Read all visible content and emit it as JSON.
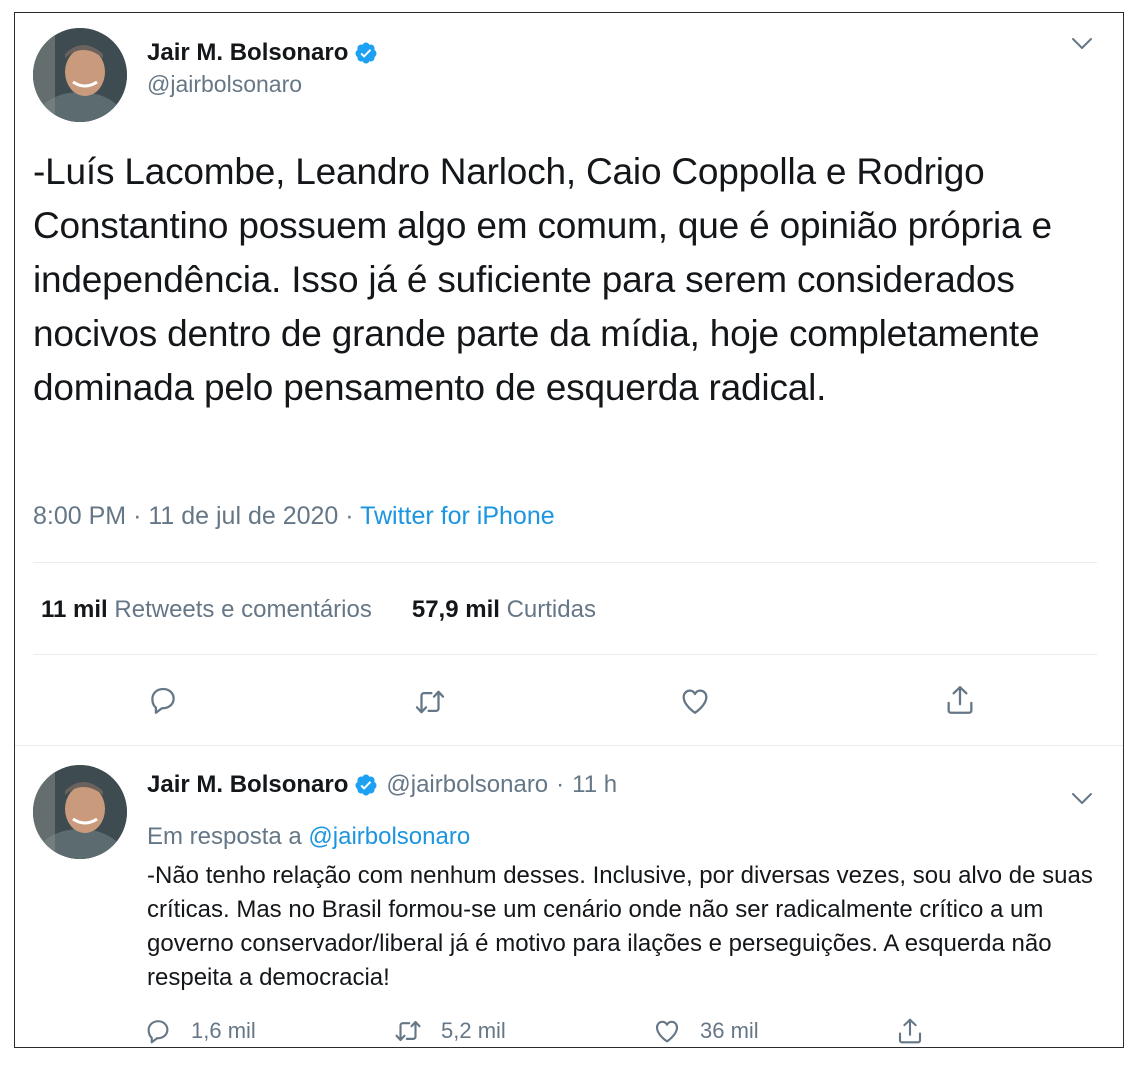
{
  "colors": {
    "text_primary": "#14171a",
    "text_secondary": "#657786",
    "link": "#1b95e0",
    "verified_badge": "#1da1f2",
    "divider": "#e6ecf0"
  },
  "main_tweet": {
    "author": {
      "name": "Jair M. Bolsonaro",
      "handle": "@jairbolsonaro",
      "verified": true
    },
    "text": "-Luís Lacombe, Leandro Narloch, Caio Coppolla e Rodrigo Constantino possuem algo em comum, que é opinião própria e independência. Isso já é suficiente para serem considerados nocivos dentro de grande parte da mídia, hoje completamente dominada pelo pensamento de esquerda radical.",
    "time": "8:00 PM",
    "date": "11 de jul de 2020",
    "separator": "·",
    "source": "Twitter for iPhone",
    "stats": {
      "retweets_count": "11 mil",
      "retweets_label": "Retweets e comentários",
      "likes_count": "57,9 mil",
      "likes_label": "Curtidas"
    },
    "actions": [
      "reply-icon",
      "retweet-icon",
      "like-icon",
      "share-icon"
    ]
  },
  "reply_tweet": {
    "author": {
      "name": "Jair M. Bolsonaro",
      "handle": "@jairbolsonaro",
      "verified": true
    },
    "separator": "·",
    "time": "11 h",
    "reply_prefix": "Em resposta a",
    "reply_to": "@jairbolsonaro",
    "text": "-Não tenho relação com nenhum desses. Inclusive, por diversas vezes, sou alvo de suas críticas. Mas no Brasil formou-se um cenário onde não ser radicalmente crítico a um governo conservador/liberal já é motivo para ilações e perseguições. A esquerda não respeita a democracia!",
    "actions": {
      "replies": "1,6 mil",
      "retweets": "5,2 mil",
      "likes": "36 mil"
    }
  }
}
